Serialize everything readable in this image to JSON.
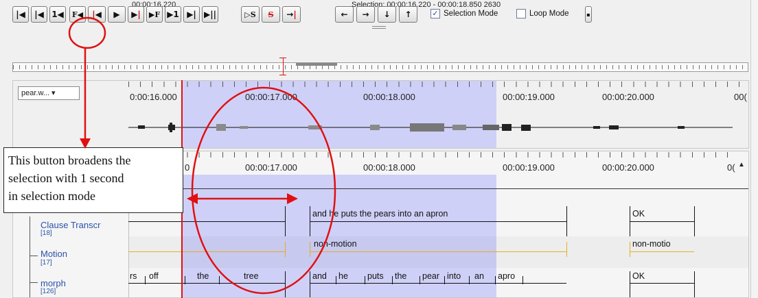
{
  "toolbar": {
    "time": "00:00:16.220",
    "selection_text": "Selection: 00:00:16.220 - 00:00:18.850  2630",
    "buttons": {
      "go_begin": "|◀",
      "prev_frame": "|◀",
      "back_1s": "1◀",
      "prev_f": "F◀",
      "prev_boundary": "◀",
      "play": "▶",
      "play_sel": "▶",
      "next_f": "▶F",
      "fwd_1s": "▶1",
      "next_frame": "▶|",
      "go_end": "▶||",
      "play_s": "▷S",
      "clear_s": "S",
      "to_sel_end": "→",
      "left": "←",
      "right": "→",
      "down": "↓",
      "up": "↑"
    },
    "selection_mode_label": "Selection Mode",
    "selection_mode_checked": "✓",
    "loop_mode_label": "Loop Mode"
  },
  "waveform": {
    "dropdown_value": "pear.w...  ▾",
    "time_labels": [
      "0:00:16.000",
      "00:00:17.000",
      "00:00:18.000",
      "00:00:19.000",
      "00:00:20.000",
      "00("
    ]
  },
  "tiers": {
    "time_labels": [
      "00:00:17.000",
      "00:00:18.000",
      "00:00:19.000",
      "00:00:20.000",
      "0(",
      "0"
    ],
    "rows": [
      {
        "name": "Clause Transcr",
        "count": "[18]"
      },
      {
        "name": "Motion",
        "count": "[17]"
      },
      {
        "name": "morph",
        "count": "[126]"
      }
    ],
    "clause_annotations": [
      "and he puts the pears into an apron",
      "OK"
    ],
    "motion_annotations": [
      "non-motion",
      "non-motio"
    ],
    "morph_annotations": [
      "rs",
      "off",
      "the",
      "tree",
      "and",
      "he",
      "puts",
      "the",
      "pear",
      "into",
      "an",
      "apro",
      "OK"
    ]
  },
  "callout": {
    "lines": [
      "This button broadens the",
      "selection with 1 second",
      "in selection mode"
    ]
  },
  "colors": {
    "selection": "#cfd0f7",
    "crosshair": "#e01010",
    "motion_line": "#e0b020",
    "annotation_red": "#e01010"
  }
}
